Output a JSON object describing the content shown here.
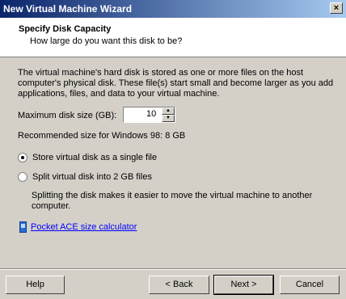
{
  "window": {
    "title": "New Virtual Machine Wizard",
    "close_glyph": "×"
  },
  "header": {
    "title": "Specify Disk Capacity",
    "subtitle": "How large do you want this disk to be?"
  },
  "body": {
    "description": "The virtual machine's hard disk is stored as one or more files on the host computer's physical disk. These file(s) start small and become larger as you add applications, files, and data to your virtual machine.",
    "size_label": "Maximum disk size (GB):",
    "size_value": "10",
    "recommended": "Recommended size for Windows 98: 8 GB",
    "options": [
      {
        "label": "Store virtual disk as a single file",
        "checked": true
      },
      {
        "label": "Split virtual disk into 2 GB files",
        "checked": false
      }
    ],
    "split_note": "Splitting the disk makes it easier to move the virtual machine to another computer.",
    "calculator_link": "Pocket ACE size calculator"
  },
  "buttons": {
    "help": "Help",
    "back": "< Back",
    "next": "Next >",
    "cancel": "Cancel"
  },
  "icons": {
    "spin_up": "▲",
    "spin_down": "▼",
    "calculator": "pda-icon"
  }
}
